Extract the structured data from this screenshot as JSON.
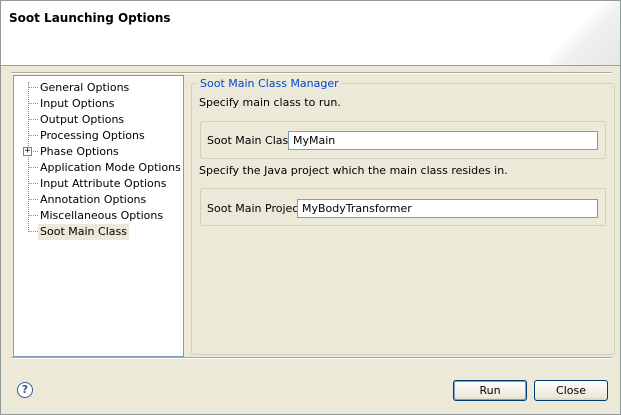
{
  "dialog": {
    "title": "Soot Launching Options"
  },
  "tree": {
    "items": [
      {
        "label": "General Options",
        "expandable": false,
        "selected": false
      },
      {
        "label": "Input Options",
        "expandable": false,
        "selected": false
      },
      {
        "label": "Output Options",
        "expandable": false,
        "selected": false
      },
      {
        "label": "Processing Options",
        "expandable": false,
        "selected": false
      },
      {
        "label": "Phase Options",
        "expandable": true,
        "selected": false
      },
      {
        "label": "Application Mode Options",
        "expandable": false,
        "selected": false
      },
      {
        "label": "Input Attribute Options",
        "expandable": false,
        "selected": false
      },
      {
        "label": "Annotation Options",
        "expandable": false,
        "selected": false
      },
      {
        "label": "Miscellaneous Options",
        "expandable": false,
        "selected": false
      },
      {
        "label": "Soot Main Class",
        "expandable": false,
        "selected": true
      }
    ],
    "expander_glyph": "+"
  },
  "panel": {
    "group_title": "Soot Main Class Manager",
    "main_class_instruction": "Specify main class to run.",
    "main_class_label": "Soot Main Class",
    "main_class_value": "MyMain",
    "project_instruction": "Specify the Java project which the main class resides in.",
    "project_label": "Soot Main Project",
    "project_value": "MyBodyTransformer"
  },
  "footer": {
    "help_glyph": "?",
    "run_label": "Run",
    "close_label": "Close"
  },
  "colors": {
    "group_title": "#0046d5",
    "dialog_bg": "#ece9d8"
  }
}
